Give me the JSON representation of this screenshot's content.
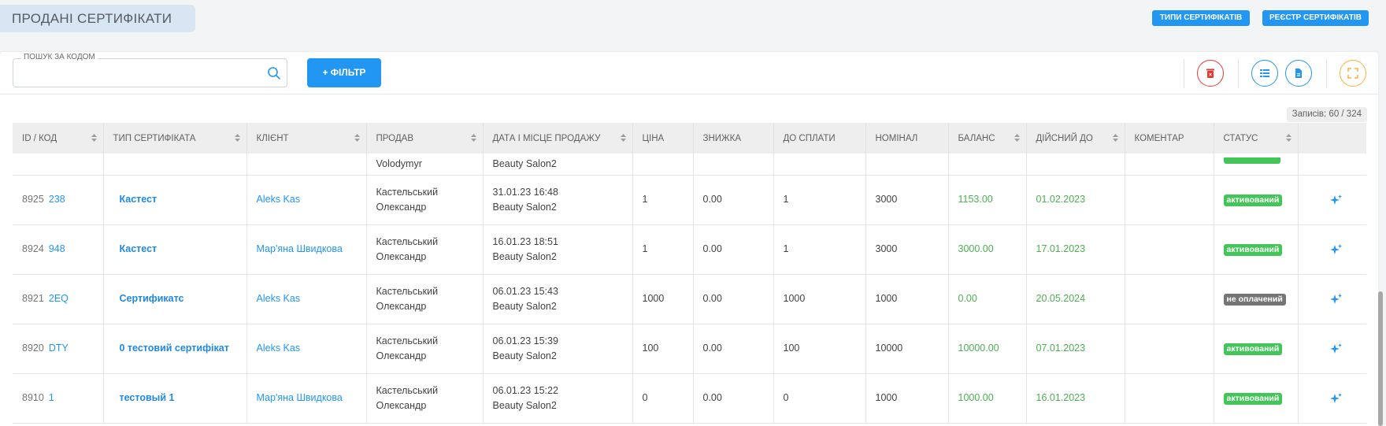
{
  "page": {
    "title": "ПРОДАНІ СЕРТИФІКАТИ"
  },
  "header_buttons": {
    "types": "ТИПИ СЕРТИФІКАТІВ",
    "registry": "РЕЄСТР СЕРТИФІКАТІВ"
  },
  "search": {
    "legend": "ПОШУК ЗА КОДОМ",
    "value": "",
    "placeholder": ""
  },
  "filter": {
    "label": "+ ФІЛЬТР"
  },
  "icons": {
    "delete": "trash-icon",
    "columns": "columns-icon",
    "export": "document-icon",
    "fullscreen": "fullscreen-icon",
    "action": "sparkle-icon"
  },
  "colors": {
    "accent": "#2196f3",
    "danger": "#e53935",
    "warning": "#fbb03b",
    "success": "#43c55a",
    "unpaid": "#757575"
  },
  "records": "Записів: 60 / 324",
  "table": {
    "columns": [
      "ID / КОД",
      "ТИП СЕРТИФІКАТА",
      "КЛІЄНТ",
      "ПРОДАВ",
      "ДАТА І МІСЦЕ ПРОДАЖУ",
      "ЦІНА",
      "ЗНИЖКА",
      "ДО СПЛАТИ",
      "НОМІНАЛ",
      "БАЛАНС",
      "ДІЙСНИЙ ДО",
      "КОМЕНТАР",
      "СТАТУС"
    ],
    "partial_row": {
      "seller_line2": "Volodymyr",
      "place": "Beauty Salon2"
    },
    "rows": [
      {
        "id": "8925",
        "code": "238",
        "type": "Кастест",
        "client": "Aleks Kas",
        "seller1": "Кастельський",
        "seller2": "Олександр",
        "date": "31.01.23 16:48",
        "place": "Beauty Salon2",
        "price": "1",
        "discount": "0.00",
        "to_pay": "1",
        "nominal": "3000",
        "balance": "1153.00",
        "valid": "01.02.2023",
        "comment": "",
        "status": "активований"
      },
      {
        "id": "8924",
        "code": "948",
        "type": "Кастест",
        "client": "Мар'яна Швидкова",
        "seller1": "Кастельський",
        "seller2": "Олександр",
        "date": "16.01.23 18:51",
        "place": "Beauty Salon2",
        "price": "1",
        "discount": "0.00",
        "to_pay": "1",
        "nominal": "3000",
        "balance": "3000.00",
        "valid": "17.01.2023",
        "comment": "",
        "status": "активований"
      },
      {
        "id": "8921",
        "code": "2EQ",
        "type": "Сертификатс",
        "client": "Aleks Kas",
        "seller1": "Кастельський",
        "seller2": "Олександр",
        "date": "06.01.23 15:43",
        "place": "Beauty Salon2",
        "price": "1000",
        "discount": "0.00",
        "to_pay": "1000",
        "nominal": "1000",
        "balance": "0.00",
        "valid": "20.05.2024",
        "comment": "",
        "status": "не оплачений"
      },
      {
        "id": "8920",
        "code": "DTY",
        "type": "0 тестовий сертифікат",
        "client": "Aleks Kas",
        "seller1": "Кастельський",
        "seller2": "Олександр",
        "date": "06.01.23 15:39",
        "place": "Beauty Salon2",
        "price": "100",
        "discount": "0.00",
        "to_pay": "100",
        "nominal": "10000",
        "balance": "10000.00",
        "valid": "07.01.2023",
        "comment": "",
        "status": "активований"
      },
      {
        "id": "8910",
        "code": "1",
        "type": "тестовый 1",
        "client": "Мар'яна Швидкова",
        "seller1": "Кастельський",
        "seller2": "Олександр",
        "date": "06.01.23 15:22",
        "place": "Beauty Salon2",
        "price": "0",
        "discount": "0.00",
        "to_pay": "0",
        "nominal": "1000",
        "balance": "1000.00",
        "valid": "16.01.2023",
        "comment": "",
        "status": "активований"
      }
    ]
  }
}
